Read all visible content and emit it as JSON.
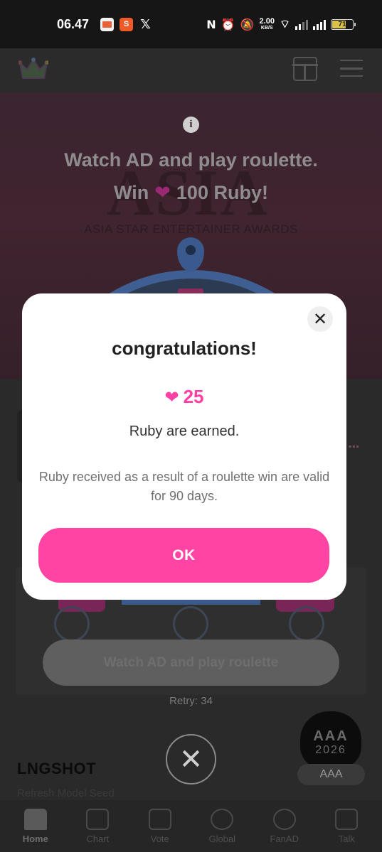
{
  "status_bar": {
    "time": "06.47",
    "notifications": [
      "photos-icon",
      "shopee-icon",
      "x-icon"
    ],
    "x_glyph": "𝕏",
    "net_speed_value": "2.00",
    "net_speed_unit": "KB/S",
    "battery_level": "71",
    "battery_fraction": 0.71
  },
  "promo": {
    "line1": "Watch AD and play roulette.",
    "line2_prefix": "Win",
    "line2_suffix": "100 Ruby!",
    "bg_word": "ASIA",
    "bg_award": "ASIA STAR ENTERTAINER AWARDS"
  },
  "roulette": {
    "watch_button_label": "Watch AD and play roulette",
    "retry_label": "Retry: 34"
  },
  "featured": {
    "title": "LNGSHOT",
    "subtitle": "Refresh Model Seed",
    "aaa_mark": "AAA",
    "aaa_year": "2026",
    "aaa_label": "AAA"
  },
  "bottom_nav": [
    {
      "label": "Home",
      "active": true
    },
    {
      "label": "Chart",
      "active": false
    },
    {
      "label": "Vote",
      "active": false
    },
    {
      "label": "Global",
      "active": false
    },
    {
      "label": "FanAD",
      "active": false
    },
    {
      "label": "Talk",
      "active": false
    }
  ],
  "dialog": {
    "title": "congratulations!",
    "reward_amount": "25",
    "earned_text": "Ruby are earned.",
    "validity_text": "Ruby received as a result of a roulette win are valid for 90 days.",
    "ok_label": "OK"
  },
  "colors": {
    "accent_pink": "#ff44a4",
    "dialog_bg": "#ffffff",
    "overlay_dim": "#2a2a2a"
  }
}
